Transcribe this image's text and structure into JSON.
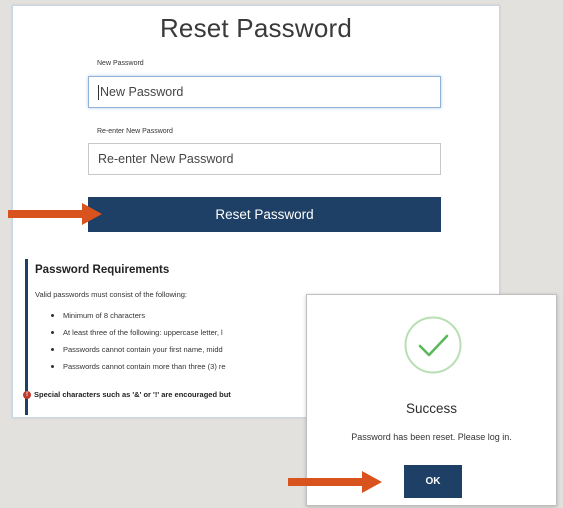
{
  "reset_form": {
    "title": "Reset Password",
    "new_password": {
      "label": "New Password",
      "placeholder": "New Password"
    },
    "confirm_password": {
      "label": "Re-enter New Password",
      "placeholder": "Re-enter New Password"
    },
    "reset_button": "Reset Password"
  },
  "requirements": {
    "heading": "Password Requirements",
    "intro": "Valid passwords must consist of the following:",
    "items": [
      "Minimum of 8 characters",
      "At least three of the following: uppercase letter, l",
      "Passwords cannot contain your first name, midd",
      "Passwords cannot contain more than three (3) re"
    ],
    "note": "Special characters such as '&' or '!' are encouraged but"
  },
  "success_modal": {
    "icon": "checkmark-circle-icon",
    "title": "Success",
    "message": "Password has been reset. Please log in.",
    "ok_button": "OK"
  },
  "colors": {
    "primary": "#1e3f66",
    "success": "#5cb85c",
    "arrow": "#d9531e",
    "background": "#e3e1dd"
  }
}
